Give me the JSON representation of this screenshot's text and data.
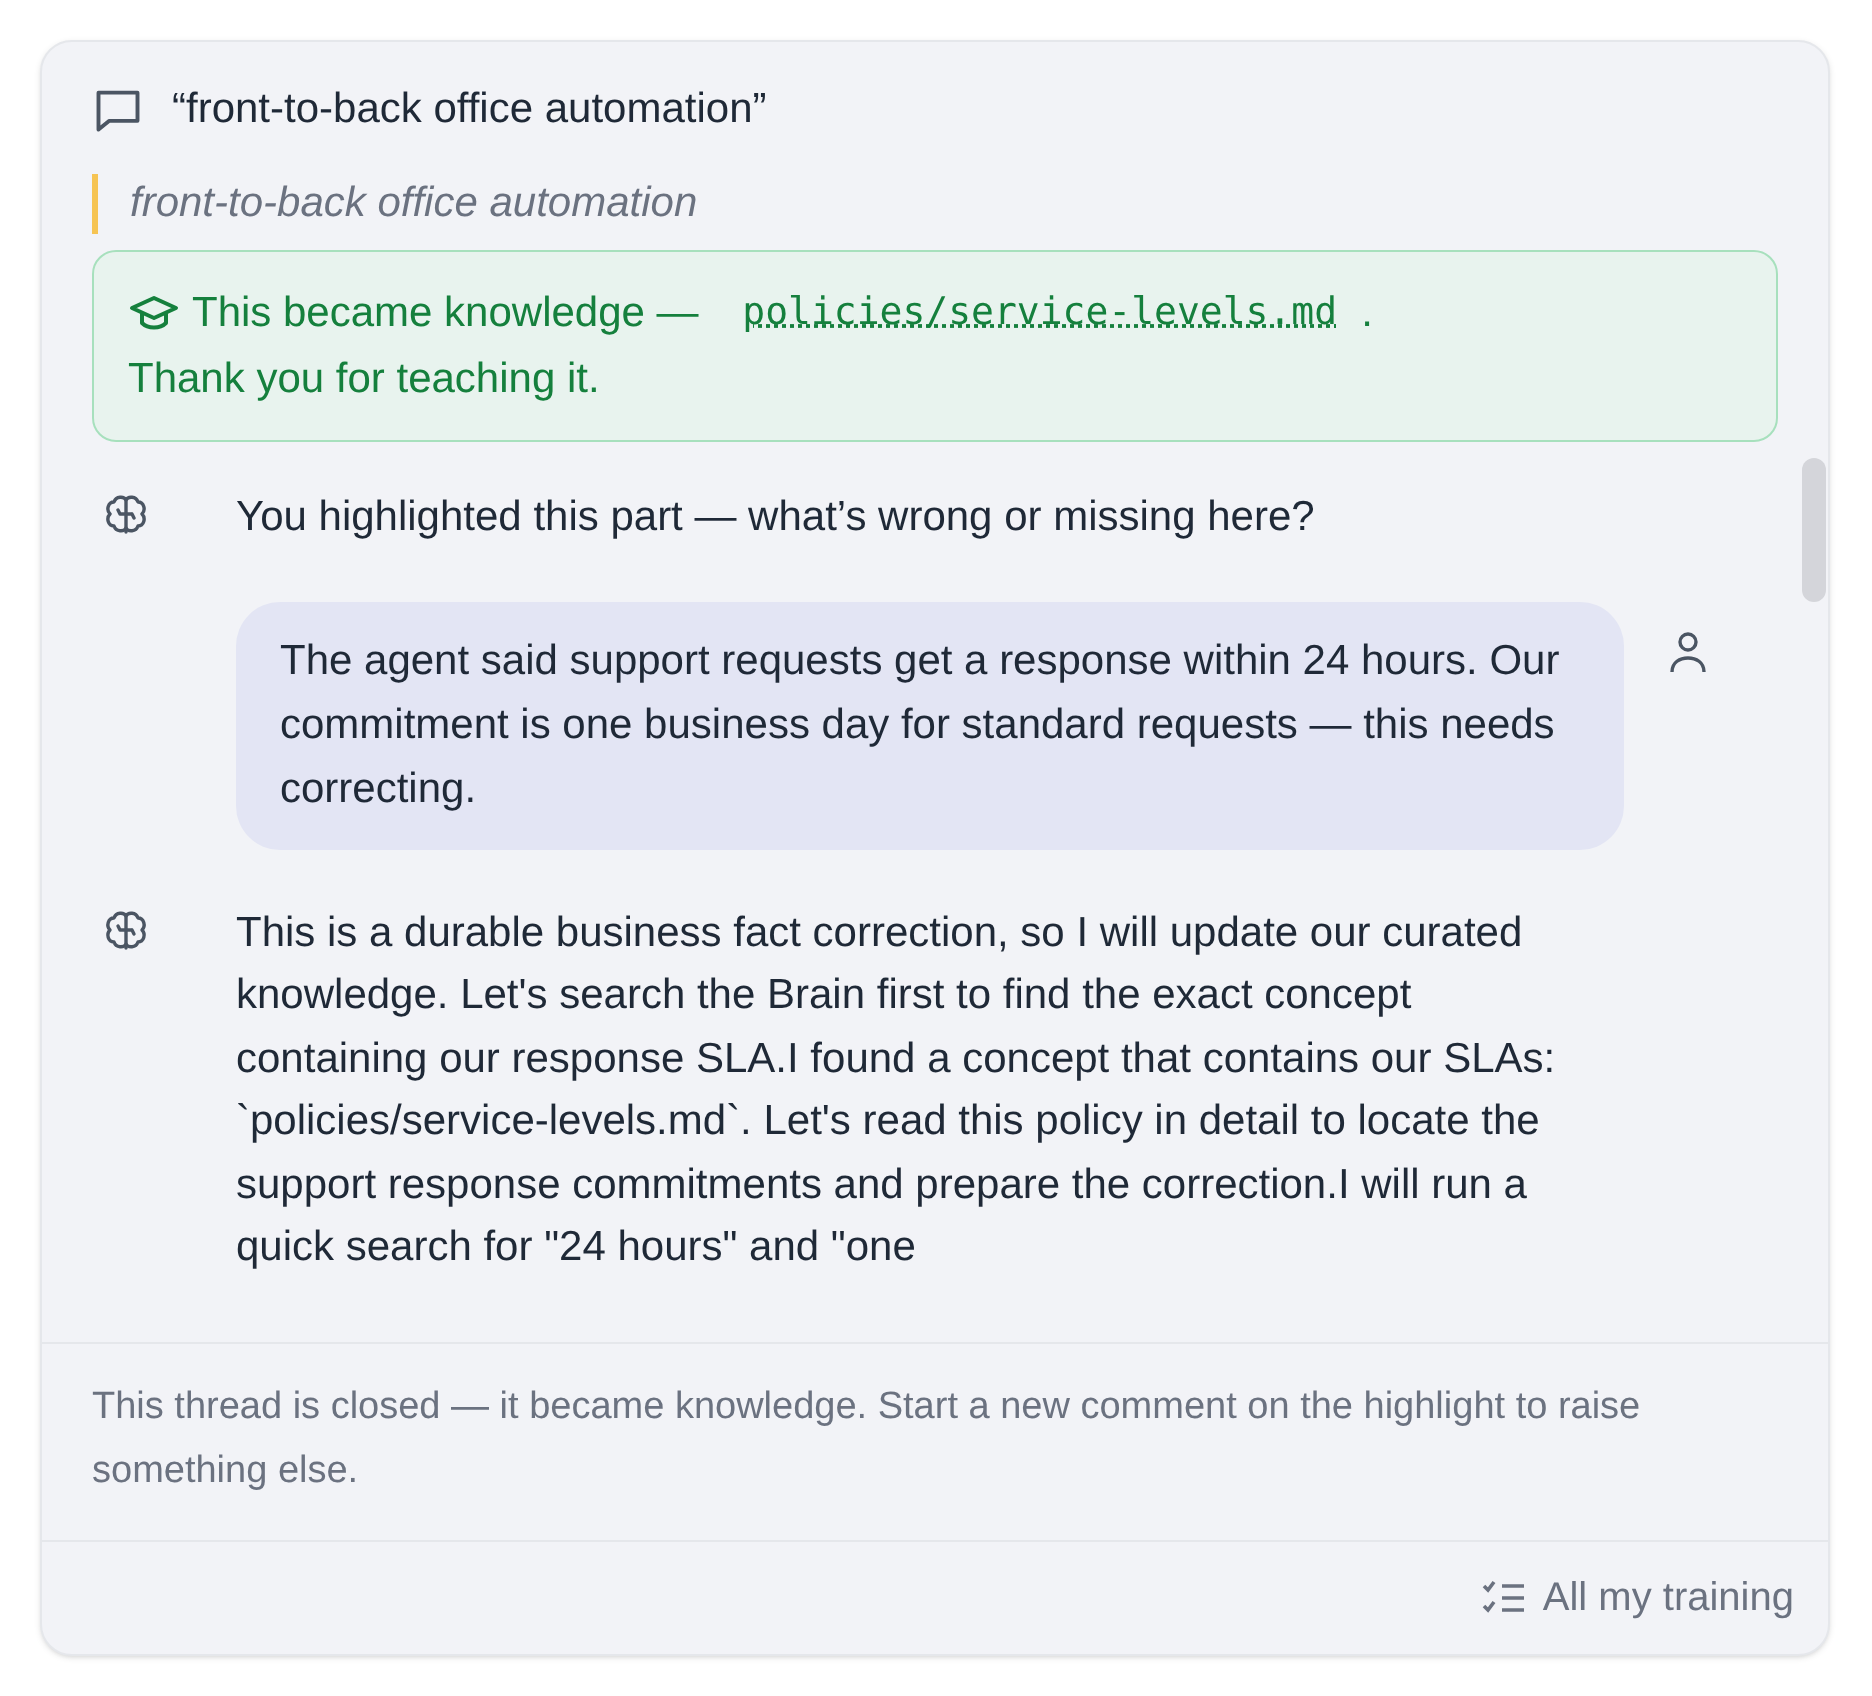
{
  "header": {
    "title": "“front-to-back office automation”"
  },
  "quote": "front-to-back office automation",
  "notice": {
    "text_before": "This became knowledge — ",
    "link": "policies/service-levels.md",
    "text_after": ".",
    "line_2": "Thank you for teaching it."
  },
  "messages": [
    {
      "kind": "assistant",
      "text": "You highlighted this part — what’s wrong or missing here?"
    },
    {
      "kind": "user",
      "text": "The agent said support requests get a response within 24 hours. Our commitment is one business day for standard requests — this needs correcting."
    },
    {
      "kind": "assistant",
      "text": "This is a durable business fact correction, so I will update our curated knowledge. Let's search the Brain first to find the exact concept containing our response SLA.I found a concept that contains our SLAs: `policies/service-levels.md`. Let's read this policy in detail to locate the support response commitments and prepare the correction.I will run a quick search for \"24 hours\" and \"one"
    }
  ],
  "closed_note": "This thread is closed — it became knowledge. Start a new comment on the highlight to raise something else.",
  "footer_link": "All my training"
}
